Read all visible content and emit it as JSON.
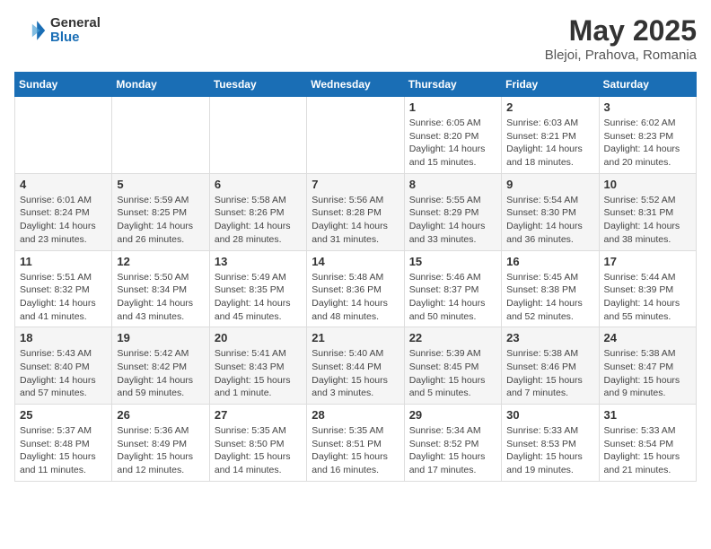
{
  "header": {
    "logo_line1": "General",
    "logo_line2": "Blue",
    "month_year": "May 2025",
    "location": "Blejoi, Prahova, Romania"
  },
  "weekdays": [
    "Sunday",
    "Monday",
    "Tuesday",
    "Wednesday",
    "Thursday",
    "Friday",
    "Saturday"
  ],
  "weeks": [
    [
      {
        "day": "",
        "info": ""
      },
      {
        "day": "",
        "info": ""
      },
      {
        "day": "",
        "info": ""
      },
      {
        "day": "",
        "info": ""
      },
      {
        "day": "1",
        "info": "Sunrise: 6:05 AM\nSunset: 8:20 PM\nDaylight: 14 hours\nand 15 minutes."
      },
      {
        "day": "2",
        "info": "Sunrise: 6:03 AM\nSunset: 8:21 PM\nDaylight: 14 hours\nand 18 minutes."
      },
      {
        "day": "3",
        "info": "Sunrise: 6:02 AM\nSunset: 8:23 PM\nDaylight: 14 hours\nand 20 minutes."
      }
    ],
    [
      {
        "day": "4",
        "info": "Sunrise: 6:01 AM\nSunset: 8:24 PM\nDaylight: 14 hours\nand 23 minutes."
      },
      {
        "day": "5",
        "info": "Sunrise: 5:59 AM\nSunset: 8:25 PM\nDaylight: 14 hours\nand 26 minutes."
      },
      {
        "day": "6",
        "info": "Sunrise: 5:58 AM\nSunset: 8:26 PM\nDaylight: 14 hours\nand 28 minutes."
      },
      {
        "day": "7",
        "info": "Sunrise: 5:56 AM\nSunset: 8:28 PM\nDaylight: 14 hours\nand 31 minutes."
      },
      {
        "day": "8",
        "info": "Sunrise: 5:55 AM\nSunset: 8:29 PM\nDaylight: 14 hours\nand 33 minutes."
      },
      {
        "day": "9",
        "info": "Sunrise: 5:54 AM\nSunset: 8:30 PM\nDaylight: 14 hours\nand 36 minutes."
      },
      {
        "day": "10",
        "info": "Sunrise: 5:52 AM\nSunset: 8:31 PM\nDaylight: 14 hours\nand 38 minutes."
      }
    ],
    [
      {
        "day": "11",
        "info": "Sunrise: 5:51 AM\nSunset: 8:32 PM\nDaylight: 14 hours\nand 41 minutes."
      },
      {
        "day": "12",
        "info": "Sunrise: 5:50 AM\nSunset: 8:34 PM\nDaylight: 14 hours\nand 43 minutes."
      },
      {
        "day": "13",
        "info": "Sunrise: 5:49 AM\nSunset: 8:35 PM\nDaylight: 14 hours\nand 45 minutes."
      },
      {
        "day": "14",
        "info": "Sunrise: 5:48 AM\nSunset: 8:36 PM\nDaylight: 14 hours\nand 48 minutes."
      },
      {
        "day": "15",
        "info": "Sunrise: 5:46 AM\nSunset: 8:37 PM\nDaylight: 14 hours\nand 50 minutes."
      },
      {
        "day": "16",
        "info": "Sunrise: 5:45 AM\nSunset: 8:38 PM\nDaylight: 14 hours\nand 52 minutes."
      },
      {
        "day": "17",
        "info": "Sunrise: 5:44 AM\nSunset: 8:39 PM\nDaylight: 14 hours\nand 55 minutes."
      }
    ],
    [
      {
        "day": "18",
        "info": "Sunrise: 5:43 AM\nSunset: 8:40 PM\nDaylight: 14 hours\nand 57 minutes."
      },
      {
        "day": "19",
        "info": "Sunrise: 5:42 AM\nSunset: 8:42 PM\nDaylight: 14 hours\nand 59 minutes."
      },
      {
        "day": "20",
        "info": "Sunrise: 5:41 AM\nSunset: 8:43 PM\nDaylight: 15 hours\nand 1 minute."
      },
      {
        "day": "21",
        "info": "Sunrise: 5:40 AM\nSunset: 8:44 PM\nDaylight: 15 hours\nand 3 minutes."
      },
      {
        "day": "22",
        "info": "Sunrise: 5:39 AM\nSunset: 8:45 PM\nDaylight: 15 hours\nand 5 minutes."
      },
      {
        "day": "23",
        "info": "Sunrise: 5:38 AM\nSunset: 8:46 PM\nDaylight: 15 hours\nand 7 minutes."
      },
      {
        "day": "24",
        "info": "Sunrise: 5:38 AM\nSunset: 8:47 PM\nDaylight: 15 hours\nand 9 minutes."
      }
    ],
    [
      {
        "day": "25",
        "info": "Sunrise: 5:37 AM\nSunset: 8:48 PM\nDaylight: 15 hours\nand 11 minutes."
      },
      {
        "day": "26",
        "info": "Sunrise: 5:36 AM\nSunset: 8:49 PM\nDaylight: 15 hours\nand 12 minutes."
      },
      {
        "day": "27",
        "info": "Sunrise: 5:35 AM\nSunset: 8:50 PM\nDaylight: 15 hours\nand 14 minutes."
      },
      {
        "day": "28",
        "info": "Sunrise: 5:35 AM\nSunset: 8:51 PM\nDaylight: 15 hours\nand 16 minutes."
      },
      {
        "day": "29",
        "info": "Sunrise: 5:34 AM\nSunset: 8:52 PM\nDaylight: 15 hours\nand 17 minutes."
      },
      {
        "day": "30",
        "info": "Sunrise: 5:33 AM\nSunset: 8:53 PM\nDaylight: 15 hours\nand 19 minutes."
      },
      {
        "day": "31",
        "info": "Sunrise: 5:33 AM\nSunset: 8:54 PM\nDaylight: 15 hours\nand 21 minutes."
      }
    ]
  ]
}
